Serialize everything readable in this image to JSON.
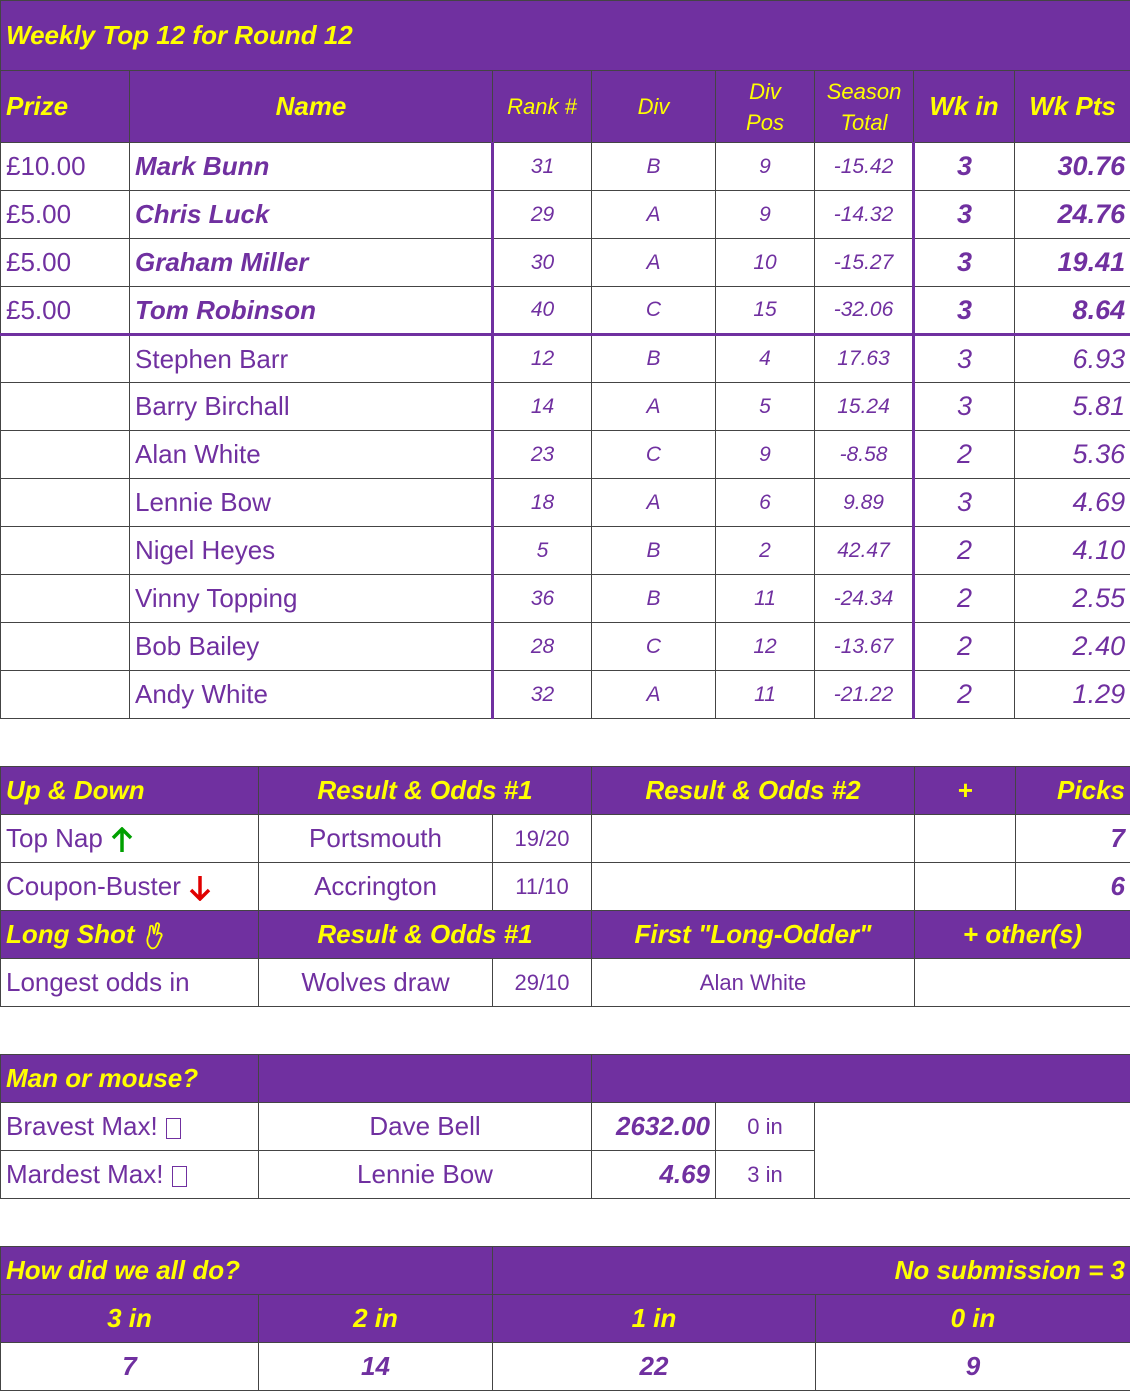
{
  "top12": {
    "title": "Weekly Top 12 for Round 12",
    "headers": {
      "prize": "Prize",
      "name": "Name",
      "rank": "Rank #",
      "div": "Div",
      "div_pos_line1": "Div",
      "div_pos_line2": "Pos",
      "season_line1": "Season",
      "season_line2": "Total",
      "wk_in": "Wk in",
      "wk_pts": "Wk Pts"
    },
    "rows": [
      {
        "prize": "£10.00",
        "name": "Mark Bunn",
        "rank": "31",
        "div": "B",
        "div_pos": "9",
        "season": "-15.42",
        "wk_in": "3",
        "wk_pts": "30.76"
      },
      {
        "prize": "£5.00",
        "name": "Chris Luck",
        "rank": "29",
        "div": "A",
        "div_pos": "9",
        "season": "-14.32",
        "wk_in": "3",
        "wk_pts": "24.76"
      },
      {
        "prize": "£5.00",
        "name": "Graham Miller",
        "rank": "30",
        "div": "A",
        "div_pos": "10",
        "season": "-15.27",
        "wk_in": "3",
        "wk_pts": "19.41"
      },
      {
        "prize": "£5.00",
        "name": "Tom Robinson",
        "rank": "40",
        "div": "C",
        "div_pos": "15",
        "season": "-32.06",
        "wk_in": "3",
        "wk_pts": "8.64"
      },
      {
        "prize": "",
        "name": "Stephen Barr",
        "rank": "12",
        "div": "B",
        "div_pos": "4",
        "season": "17.63",
        "wk_in": "3",
        "wk_pts": "6.93"
      },
      {
        "prize": "",
        "name": "Barry Birchall",
        "rank": "14",
        "div": "A",
        "div_pos": "5",
        "season": "15.24",
        "wk_in": "3",
        "wk_pts": "5.81"
      },
      {
        "prize": "",
        "name": "Alan White",
        "rank": "23",
        "div": "C",
        "div_pos": "9",
        "season": "-8.58",
        "wk_in": "2",
        "wk_pts": "5.36"
      },
      {
        "prize": "",
        "name": "Lennie Bow",
        "rank": "18",
        "div": "A",
        "div_pos": "6",
        "season": "9.89",
        "wk_in": "3",
        "wk_pts": "4.69"
      },
      {
        "prize": "",
        "name": "Nigel Heyes",
        "rank": "5",
        "div": "B",
        "div_pos": "2",
        "season": "42.47",
        "wk_in": "2",
        "wk_pts": "4.10"
      },
      {
        "prize": "",
        "name": "Vinny Topping",
        "rank": "36",
        "div": "B",
        "div_pos": "11",
        "season": "-24.34",
        "wk_in": "2",
        "wk_pts": "2.55"
      },
      {
        "prize": "",
        "name": "Bob Bailey",
        "rank": "28",
        "div": "C",
        "div_pos": "12",
        "season": "-13.67",
        "wk_in": "2",
        "wk_pts": "2.40"
      },
      {
        "prize": "",
        "name": "Andy White",
        "rank": "32",
        "div": "A",
        "div_pos": "11",
        "season": "-21.22",
        "wk_in": "2",
        "wk_pts": "1.29"
      }
    ]
  },
  "updown": {
    "headers": {
      "label": "Up & Down",
      "result1": "Result & Odds #1",
      "result2": "Result & Odds #2",
      "plus": "+",
      "picks": "Picks"
    },
    "rows": [
      {
        "label": "Top Nap",
        "icon": "up-arrow-icon",
        "icon_color": "#00a000",
        "team": "Portsmouth",
        "odds": "19/20",
        "picks": "7"
      },
      {
        "label": "Coupon-Buster",
        "icon": "down-arrow-icon",
        "icon_color": "#e00000",
        "team": "Accrington",
        "odds": "11/10",
        "picks": "6"
      }
    ],
    "longshot_headers": {
      "label": "Long Shot",
      "result1": "Result & Odds #1",
      "first": "First \"Long-Odder\"",
      "others": "+ other(s)"
    },
    "longshot_row": {
      "label": "Longest odds in",
      "team": "Wolves draw",
      "odds": "29/10",
      "first": "Alan White"
    }
  },
  "manmouse": {
    "header": "Man or mouse?",
    "rows": [
      {
        "label": "Bravest Max!",
        "name": "Dave Bell",
        "value": "2632.00",
        "in": "0 in"
      },
      {
        "label": "Mardest Max!",
        "name": "Lennie Bow",
        "value": "4.69",
        "in": "3 in"
      }
    ]
  },
  "summary": {
    "title": "How did we all do?",
    "note": "No submission = 3",
    "headers": [
      "3 in",
      "2 in",
      "1 in",
      "0 in"
    ],
    "counts": [
      "7",
      "14",
      "22",
      "9"
    ]
  },
  "colors": {
    "purple": "#7030a0",
    "yellow": "#ffff00"
  }
}
